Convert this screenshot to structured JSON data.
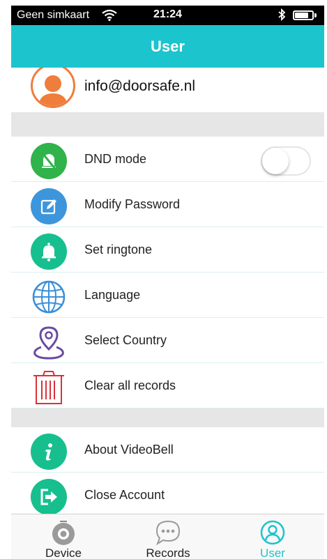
{
  "status_bar": {
    "carrier": "Geen simkaart",
    "time": "21:24",
    "battery_level": 0.8
  },
  "header": {
    "title": "User"
  },
  "profile": {
    "email": "info@doorsafe.nl"
  },
  "menu": {
    "dnd": {
      "label": "DND mode",
      "enabled": false
    },
    "modify_password": {
      "label": "Modify Password"
    },
    "set_ringtone": {
      "label": "Set ringtone"
    },
    "language": {
      "label": "Language"
    },
    "select_country": {
      "label": "Select Country"
    },
    "clear_records": {
      "label": "Clear all records"
    },
    "about": {
      "label": "About VideoBell"
    },
    "close_account": {
      "label": "Close Account"
    }
  },
  "tabs": [
    {
      "label": "Device",
      "icon": "camera-icon",
      "active": false
    },
    {
      "label": "Records",
      "icon": "chat-bubble-icon",
      "active": false
    },
    {
      "label": "User",
      "icon": "user-icon",
      "active": true
    }
  ],
  "colors": {
    "accent": "#1cc4cd",
    "avatar_ring": "#ef7d3c",
    "dnd_icon": "#2fb34a",
    "password_icon": "#3d96dc",
    "ringtone_icon": "#17bf8e",
    "language_icon": "#3a8fd8",
    "country_icon": "#6a4aa5",
    "clear_icon": "#d9323a",
    "about_icon": "#17bf8e",
    "close_icon": "#17bf8e"
  }
}
